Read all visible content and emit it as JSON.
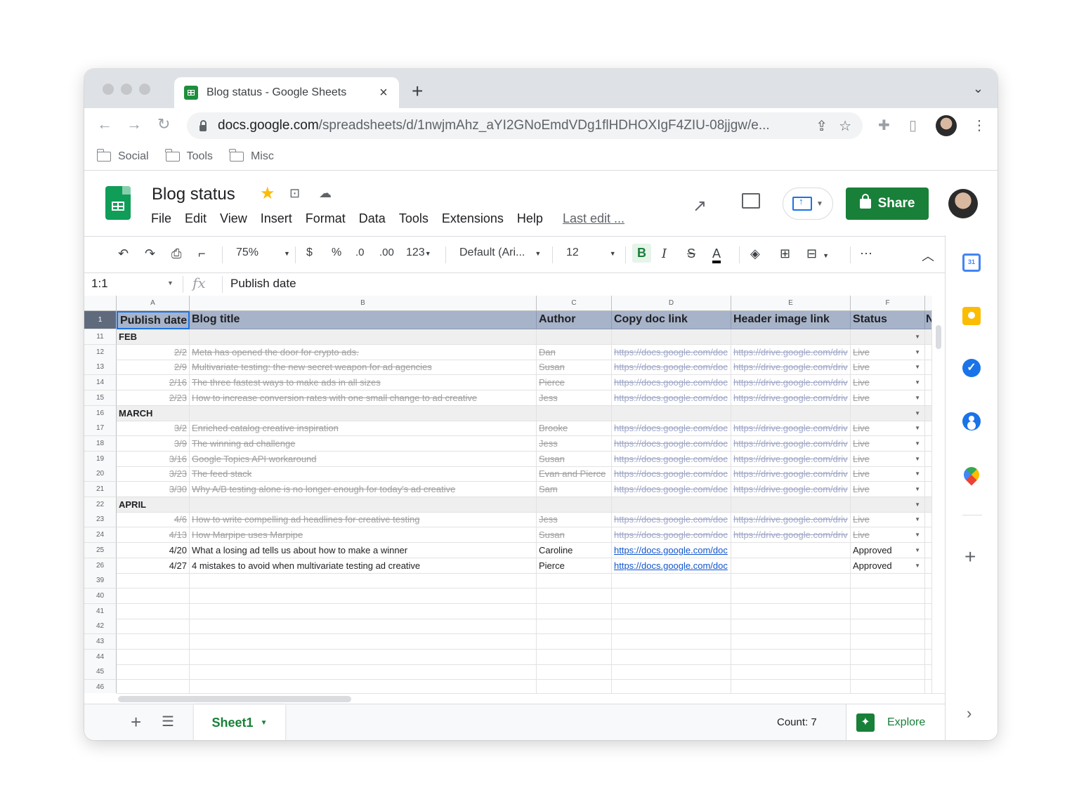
{
  "browser": {
    "tab_title": "Blog status - Google Sheets",
    "tab_close": "×",
    "new_tab": "+",
    "url_domain": "docs.google.com",
    "url_path": "/spreadsheets/d/1nwjmAhz_aYI2GNoEmdVDg1flHDHOXIgF4ZIU-08jjgw/e...",
    "bookmarks": [
      "Social",
      "Tools",
      "Misc"
    ]
  },
  "app": {
    "title": "Blog status",
    "menus": [
      "File",
      "Edit",
      "View",
      "Insert",
      "Format",
      "Data",
      "Tools",
      "Extensions",
      "Help"
    ],
    "last_edit": "Last edit ...",
    "share_label": "Share"
  },
  "toolbar": {
    "zoom": "75%",
    "currency": "$",
    "percent": "%",
    "dec_decrease": ".0",
    "dec_increase": ".00",
    "number_format": "123",
    "font": "Default (Ari...",
    "font_size": "12",
    "bold": "B",
    "italic": "I",
    "strike": "S",
    "text_color": "A",
    "more": "⋯"
  },
  "formula_bar": {
    "cell_ref": "1:1",
    "fx": "fx",
    "value": "Publish date"
  },
  "grid": {
    "columns": [
      "A",
      "B",
      "C",
      "D",
      "E",
      "F"
    ],
    "header": [
      "Publish date",
      "Blog title",
      "Author",
      "Copy doc link",
      "Header image link",
      "Status",
      "N"
    ],
    "rows": [
      {
        "n": "11",
        "type": "section",
        "label": "FEB"
      },
      {
        "n": "12",
        "type": "done",
        "date": "2/2",
        "title": "Meta has opened the door for crypto ads.",
        "author": "Dan",
        "doc": "https://docs.google.com/doc",
        "img": "https://drive.google.com/driv",
        "status": "Live"
      },
      {
        "n": "13",
        "type": "done",
        "date": "2/9",
        "title": "Multivariate testing: the new secret weapon for ad agencies",
        "author": "Susan",
        "doc": "https://docs.google.com/doc",
        "img": "https://drive.google.com/driv",
        "status": "Live"
      },
      {
        "n": "14",
        "type": "done",
        "date": "2/16",
        "title": "The three fastest ways to make ads in all sizes",
        "author": "Pierce",
        "doc": "https://docs.google.com/doc",
        "img": "https://drive.google.com/driv",
        "status": "Live"
      },
      {
        "n": "15",
        "type": "done",
        "date": "2/23",
        "title": "How to increase conversion rates with one small change to ad creative",
        "author": "Jess",
        "doc": "https://docs.google.com/doc",
        "img": "https://drive.google.com/driv",
        "status": "Live"
      },
      {
        "n": "16",
        "type": "section",
        "label": "MARCH"
      },
      {
        "n": "17",
        "type": "done",
        "date": "3/2",
        "title": "Enriched catalog creative inspiration",
        "author": "Brooke",
        "doc": "https://docs.google.com/doc",
        "img": "https://drive.google.com/driv",
        "status": "Live"
      },
      {
        "n": "18",
        "type": "done",
        "date": "3/9",
        "title": "The winning ad challenge",
        "author": "Jess",
        "doc": "https://docs.google.com/doc",
        "img": "https://drive.google.com/driv",
        "status": "Live"
      },
      {
        "n": "19",
        "type": "done",
        "date": "3/16",
        "title": "Google Topics API workaround",
        "author": "Susan",
        "doc": "https://docs.google.com/doc",
        "img": "https://drive.google.com/driv",
        "status": "Live"
      },
      {
        "n": "20",
        "type": "done",
        "date": "3/23",
        "title": "The feed stack",
        "author": "Evan and Pierce",
        "doc": "https://docs.google.com/doc",
        "img": "https://drive.google.com/driv",
        "status": "Live"
      },
      {
        "n": "21",
        "type": "done",
        "date": "3/30",
        "title": "Why A/B testing alone is no longer enough for today's ad creative",
        "author": "Sam",
        "doc": "https://docs.google.com/doc",
        "img": "https://drive.google.com/driv",
        "status": "Live"
      },
      {
        "n": "22",
        "type": "section",
        "label": "APRIL"
      },
      {
        "n": "23",
        "type": "done",
        "date": "4/6",
        "title": "How to write compelling ad headlines for creative testing",
        "author": "Jess",
        "doc": "https://docs.google.com/doc",
        "img": "https://drive.google.com/driv",
        "status": "Live"
      },
      {
        "n": "24",
        "type": "done",
        "date": "4/13",
        "title": "How Marpipe uses Marpipe",
        "author": "Susan",
        "doc": "https://docs.google.com/doc",
        "img": "https://drive.google.com/driv",
        "status": "Live"
      },
      {
        "n": "25",
        "type": "active",
        "date": "4/20",
        "title": "What a losing ad tells us about how to make a winner",
        "author": "Caroline",
        "doc": "https://docs.google.com/doc",
        "img": "",
        "status": "Approved"
      },
      {
        "n": "26",
        "type": "active",
        "date": "4/27",
        "title": "4 mistakes to avoid when multivariate testing ad creative",
        "author": "Pierce",
        "doc": "https://docs.google.com/doc",
        "img": "",
        "status": "Approved"
      },
      {
        "n": "39",
        "type": "empty"
      },
      {
        "n": "40",
        "type": "empty"
      },
      {
        "n": "41",
        "type": "empty"
      },
      {
        "n": "42",
        "type": "empty"
      },
      {
        "n": "43",
        "type": "empty"
      },
      {
        "n": "44",
        "type": "empty"
      },
      {
        "n": "45",
        "type": "empty"
      },
      {
        "n": "46",
        "type": "empty"
      }
    ]
  },
  "bottom": {
    "sheet_name": "Sheet1",
    "count": "Count: 7",
    "explore": "Explore"
  },
  "side_panel": {
    "calendar_day": "31"
  },
  "colors": {
    "header_fill": "#a7b3c9",
    "section_fill": "#efefef",
    "share_green": "#188038"
  }
}
